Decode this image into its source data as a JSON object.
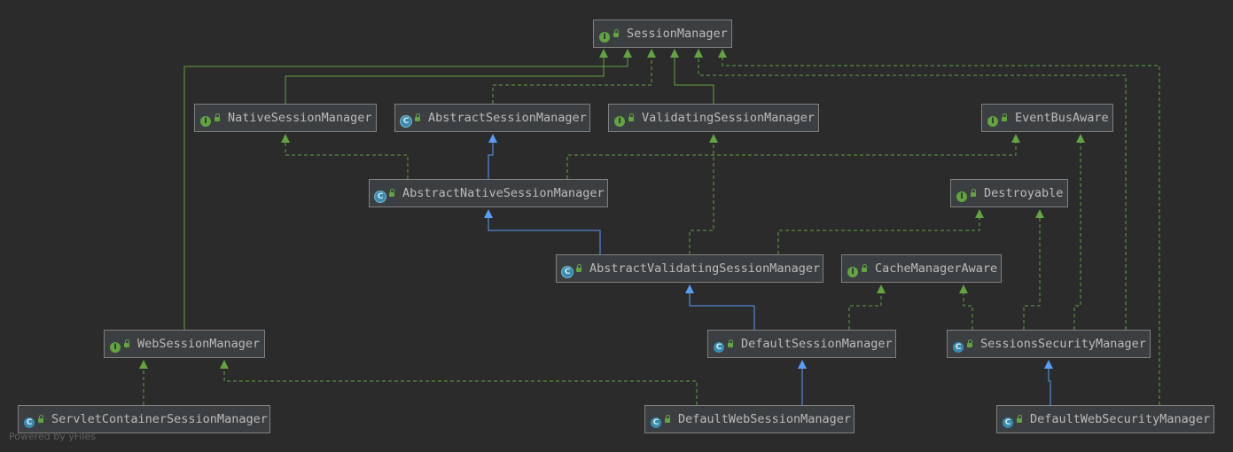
{
  "diagram": {
    "nodes": [
      {
        "id": "SessionManager",
        "label": "SessionManager",
        "kind": "interface"
      },
      {
        "id": "NativeSessionManager",
        "label": "NativeSessionManager",
        "kind": "interface"
      },
      {
        "id": "AbstractSessionManager",
        "label": "AbstractSessionManager",
        "kind": "abstract"
      },
      {
        "id": "ValidatingSessionManager",
        "label": "ValidatingSessionManager",
        "kind": "interface"
      },
      {
        "id": "EventBusAware",
        "label": "EventBusAware",
        "kind": "interface"
      },
      {
        "id": "AbstractNativeSessionManager",
        "label": "AbstractNativeSessionManager",
        "kind": "abstract"
      },
      {
        "id": "Destroyable",
        "label": "Destroyable",
        "kind": "interface"
      },
      {
        "id": "AbstractValidatingSessionManager",
        "label": "AbstractValidatingSessionManager",
        "kind": "abstract"
      },
      {
        "id": "CacheManagerAware",
        "label": "CacheManagerAware",
        "kind": "interface"
      },
      {
        "id": "WebSessionManager",
        "label": "WebSessionManager",
        "kind": "interface"
      },
      {
        "id": "DefaultSessionManager",
        "label": "DefaultSessionManager",
        "kind": "class"
      },
      {
        "id": "SessionsSecurityManager",
        "label": "SessionsSecurityManager",
        "kind": "class"
      },
      {
        "id": "ServletContainerSessionManager",
        "label": "ServletContainerSessionManager",
        "kind": "class"
      },
      {
        "id": "DefaultWebSessionManager",
        "label": "DefaultWebSessionManager",
        "kind": "class"
      },
      {
        "id": "DefaultWebSecurityManager",
        "label": "DefaultWebSecurityManager",
        "kind": "class"
      }
    ],
    "edges": [
      {
        "from": "NativeSessionManager",
        "to": "SessionManager",
        "type": "extends-interface"
      },
      {
        "from": "AbstractSessionManager",
        "to": "SessionManager",
        "type": "implements"
      },
      {
        "from": "ValidatingSessionManager",
        "to": "SessionManager",
        "type": "extends-interface"
      },
      {
        "from": "WebSessionManager",
        "to": "SessionManager",
        "type": "extends-interface"
      },
      {
        "from": "SessionsSecurityManager",
        "to": "SessionManager",
        "type": "implements"
      },
      {
        "from": "DefaultWebSecurityManager",
        "to": "SessionManager",
        "type": "implements"
      },
      {
        "from": "AbstractNativeSessionManager",
        "to": "NativeSessionManager",
        "type": "implements"
      },
      {
        "from": "AbstractNativeSessionManager",
        "to": "AbstractSessionManager",
        "type": "extends"
      },
      {
        "from": "AbstractNativeSessionManager",
        "to": "EventBusAware",
        "type": "implements"
      },
      {
        "from": "AbstractValidatingSessionManager",
        "to": "AbstractNativeSessionManager",
        "type": "extends"
      },
      {
        "from": "AbstractValidatingSessionManager",
        "to": "ValidatingSessionManager",
        "type": "implements"
      },
      {
        "from": "AbstractValidatingSessionManager",
        "to": "Destroyable",
        "type": "implements"
      },
      {
        "from": "DefaultSessionManager",
        "to": "AbstractValidatingSessionManager",
        "type": "extends"
      },
      {
        "from": "DefaultSessionManager",
        "to": "CacheManagerAware",
        "type": "implements"
      },
      {
        "from": "SessionsSecurityManager",
        "to": "CacheManagerAware",
        "type": "implements"
      },
      {
        "from": "SessionsSecurityManager",
        "to": "Destroyable",
        "type": "implements"
      },
      {
        "from": "SessionsSecurityManager",
        "to": "EventBusAware",
        "type": "implements"
      },
      {
        "from": "ServletContainerSessionManager",
        "to": "WebSessionManager",
        "type": "implements"
      },
      {
        "from": "DefaultWebSessionManager",
        "to": "WebSessionManager",
        "type": "implements"
      },
      {
        "from": "DefaultWebSessionManager",
        "to": "DefaultSessionManager",
        "type": "extends"
      },
      {
        "from": "DefaultWebSecurityManager",
        "to": "SessionsSecurityManager",
        "type": "extends"
      }
    ]
  },
  "badges": {
    "interface": "I",
    "class": "C",
    "abstract": "C"
  },
  "colors": {
    "background": "#2b2b2b",
    "node_fill": "#3c3f41",
    "node_border": "#808080",
    "text": "#bbbbbb",
    "interface_edge": "#62a342",
    "class_edge": "#589df6"
  },
  "watermark": "Powered by yFiles"
}
